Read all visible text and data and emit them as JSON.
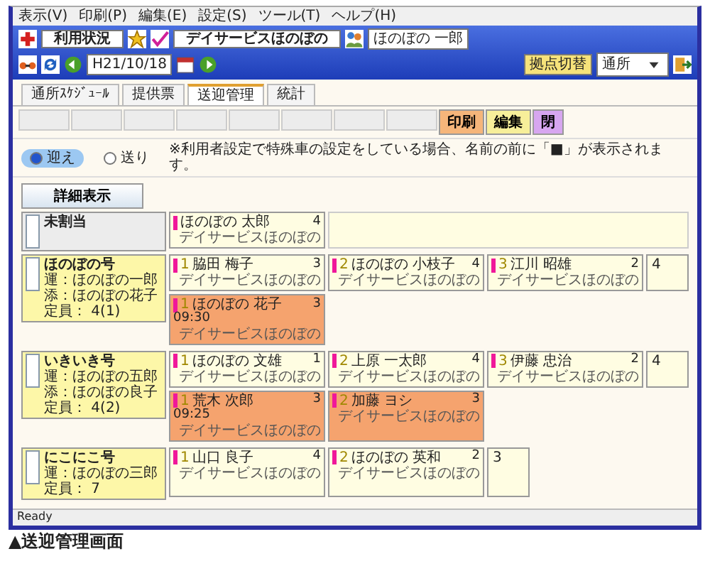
{
  "menu": [
    "表示(V)",
    "印刷(P)",
    "編集(E)",
    "設定(S)",
    "ツール(T)",
    "ヘルプ(H)"
  ],
  "toolbar": {
    "status_title": "利用状況",
    "facility": "デイサービスほのぼの",
    "user": "ほのぼの 一郎",
    "date": "H21/10/18",
    "switch_label": "拠点切替",
    "switch_value": "通所"
  },
  "tabs": [
    {
      "label": "通所ｽｹｼﾞｭｰﾙ",
      "selected": false
    },
    {
      "label": "提供票",
      "selected": false
    },
    {
      "label": "送迎管理",
      "selected": true
    },
    {
      "label": "統計",
      "selected": false
    }
  ],
  "actions": [
    {
      "label": "印刷",
      "kind": "print"
    },
    {
      "label": "編集",
      "kind": "edit"
    },
    {
      "label": "閉",
      "kind": "close"
    }
  ],
  "direction": [
    {
      "label": "迎え",
      "selected": true
    },
    {
      "label": "送り",
      "selected": false
    }
  ],
  "notice": "※利用者設定で特殊車の設定をしている場合、名前の前に「■」が表示されます。",
  "detail_button": "詳細表示",
  "groups": [
    {
      "name": "未割当",
      "kind": "unassigned",
      "checked": false,
      "rows": [
        [
          {
            "kind": "person",
            "name": "ほのぼの 太郎",
            "count": "4",
            "place": "デイサービスほのぼの",
            "highlight": false
          }
        ]
      ]
    },
    {
      "name": "ほのぼの号",
      "kind": "vehicle",
      "checked": false,
      "staff": [
        "運：ほのぼの一郎",
        "添：ほのぼの花子"
      ],
      "capacity": "定員： 4(1)",
      "rows": [
        [
          {
            "kind": "person",
            "seat": "1",
            "name": "脇田 梅子",
            "count": "3",
            "place": "デイサービスほのぼの",
            "highlight": false
          },
          {
            "kind": "person",
            "seat": "2",
            "name": "ほのぼの 小枝子",
            "count": "4",
            "place": "デイサービスほのぼの",
            "highlight": false
          },
          {
            "kind": "person",
            "seat": "3",
            "name": "江川 昭雄",
            "count": "2",
            "place": "デイサービスほのぼの",
            "highlight": false
          },
          {
            "kind": "empty",
            "seat": "4"
          }
        ],
        [
          {
            "kind": "person",
            "seat": "1",
            "name": "ほのぼの 花子",
            "count": "3",
            "time": "09:30",
            "place": "デイサービスほのぼの",
            "highlight": true
          }
        ]
      ]
    },
    {
      "name": "いきいき号",
      "kind": "vehicle",
      "checked": false,
      "staff": [
        "運：ほのぼの五郎",
        "添：ほのぼの良子"
      ],
      "capacity": "定員： 4(2)",
      "rows": [
        [
          {
            "kind": "person",
            "seat": "1",
            "name": "ほのぼの 文雄",
            "count": "1",
            "place": "デイサービスほのぼの",
            "highlight": false
          },
          {
            "kind": "person",
            "seat": "2",
            "name": "上原 一太郎",
            "count": "4",
            "place": "デイサービスほのぼの",
            "highlight": false
          },
          {
            "kind": "person",
            "seat": "3",
            "name": "伊藤 忠治",
            "count": "2",
            "place": "デイサービスほのぼの",
            "highlight": false
          },
          {
            "kind": "empty",
            "seat": "4"
          }
        ],
        [
          {
            "kind": "person",
            "seat": "1",
            "name": "荒木 次郎",
            "count": "3",
            "time": "09:25",
            "place": "デイサービスほのぼの",
            "highlight": true
          },
          {
            "kind": "person",
            "seat": "2",
            "name": "加藤 ヨシ",
            "count": "3",
            "place": "デイサービスほのぼの",
            "highlight": true
          }
        ]
      ]
    },
    {
      "name": "にこにこ号",
      "kind": "vehicle",
      "checked": false,
      "staff": [
        "運：ほのぼの三郎"
      ],
      "capacity": "定員： 7",
      "rows": [
        [
          {
            "kind": "person",
            "seat": "1",
            "name": "山口 良子",
            "count": "4",
            "place": "デイサービスほのぼの",
            "highlight": false
          },
          {
            "kind": "person",
            "seat": "2",
            "name": "ほのぼの 英和",
            "count": "2",
            "place": "デイサービスほのぼの",
            "highlight": false
          },
          {
            "kind": "empty",
            "seat": "3"
          }
        ]
      ]
    }
  ],
  "status_bar": "Ready",
  "caption": "▲送迎管理画面"
}
